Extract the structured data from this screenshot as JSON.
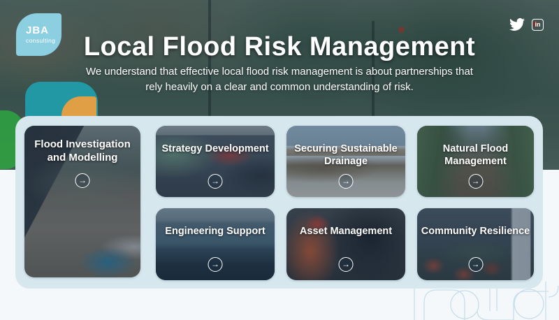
{
  "brand": {
    "name": "JBA",
    "tagline": "consulting"
  },
  "hero": {
    "title": "Local Flood Risk Management",
    "subtitle": "We understand that effective local flood risk management is about partnerships that rely heavily on a clear and common understanding of risk."
  },
  "social": {
    "linkedin_label": "in"
  },
  "icons": {
    "arrow": "→"
  },
  "cards": [
    {
      "label": "Flood Investigation and Modelling"
    },
    {
      "label": "Strategy Development"
    },
    {
      "label": "Securing Sustainable Drainage"
    },
    {
      "label": "Natural Flood Management"
    },
    {
      "label": "Engineering Support"
    },
    {
      "label": "Asset Management"
    },
    {
      "label": "Community Resilience"
    }
  ],
  "colors": {
    "panel": "#d7e7ee",
    "page_background": "#f4f8fa",
    "logo_blue": "#8ccfe0",
    "deco_teal": "#1fa5b5",
    "deco_orange": "#f2a03d",
    "deco_green": "#2f9e41",
    "pattern_line": "#c6deec",
    "text": "#ffffff"
  }
}
